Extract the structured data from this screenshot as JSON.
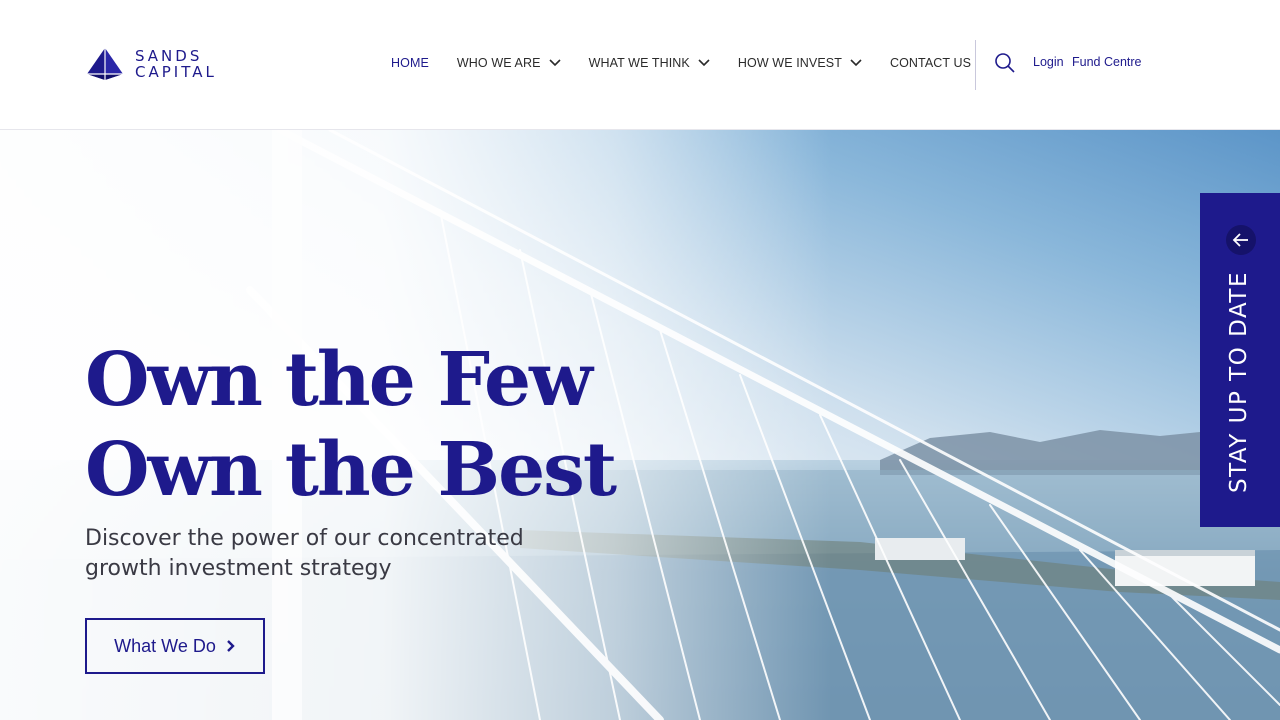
{
  "brand": {
    "line1": "SANDS",
    "line2": "CAPITAL",
    "color": "#1e1a8c"
  },
  "nav": {
    "items": [
      {
        "label": "HOME",
        "active": true,
        "dropdown": false
      },
      {
        "label": "WHO WE ARE",
        "active": false,
        "dropdown": true
      },
      {
        "label": "WHAT WE THINK",
        "active": false,
        "dropdown": true
      },
      {
        "label": "HOW WE INVEST",
        "active": false,
        "dropdown": true
      },
      {
        "label": "CONTACT US",
        "active": false,
        "dropdown": false
      }
    ],
    "search_icon": "search-icon",
    "login_label": "Login",
    "fund_centre_label": "Fund Centre"
  },
  "hero": {
    "headline_line1": "Own the Few",
    "headline_line2": "Own the Best",
    "subhead": "Discover the power of our concentrated growth investment strategy",
    "cta_label": "What We Do",
    "cta_icon": "chevron-right-icon"
  },
  "side_tab": {
    "label": "STAY UP TO DATE",
    "icon": "arrow-left-icon"
  }
}
